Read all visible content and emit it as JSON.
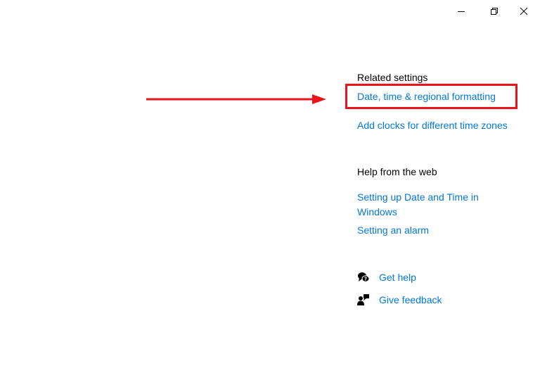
{
  "window": {
    "minimize_icon": "minimize-icon",
    "restore_icon": "restore-icon",
    "close_icon": "close-icon"
  },
  "related_settings": {
    "heading": "Related settings",
    "links": [
      "Date, time & regional formatting",
      "Add clocks for different time zones"
    ]
  },
  "help_from_web": {
    "heading": "Help from the web",
    "links": [
      "Setting up Date and Time in Windows",
      "Setting an alarm"
    ]
  },
  "support": {
    "get_help": {
      "label": "Get help",
      "icon": "get-help-icon"
    },
    "give_feedback": {
      "label": "Give feedback",
      "icon": "feedback-icon"
    }
  },
  "annotation": {
    "highlight_color": "#e8141c",
    "arrow_color": "#e8141c"
  },
  "colors": {
    "link": "#0078d7",
    "text": "#000000",
    "background": "#ffffff"
  }
}
